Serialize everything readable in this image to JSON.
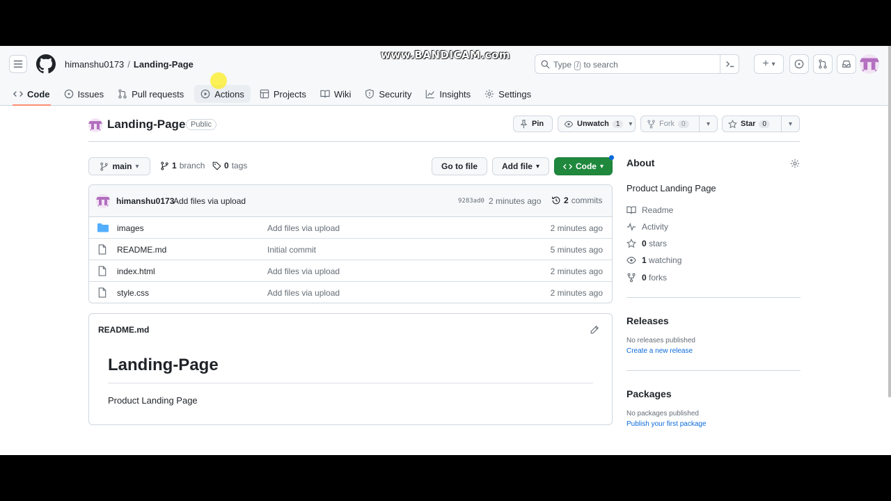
{
  "watermark": "www.BANDICAM.com",
  "header": {
    "owner": "himanshu0173",
    "separator": "/",
    "repo": "Landing-Page",
    "search_placeholder_a": "Type",
    "search_key": "/",
    "search_placeholder_b": "to search",
    "plus": "+",
    "caret": "▾"
  },
  "tabs": [
    {
      "label": "Code"
    },
    {
      "label": "Issues"
    },
    {
      "label": "Pull requests"
    },
    {
      "label": "Actions"
    },
    {
      "label": "Projects"
    },
    {
      "label": "Wiki"
    },
    {
      "label": "Security"
    },
    {
      "label": "Insights"
    },
    {
      "label": "Settings"
    }
  ],
  "repo": {
    "name": "Landing-Page",
    "visibility": "Public",
    "pin": "Pin",
    "unwatch": "Unwatch",
    "watch_count": "1",
    "fork": "Fork",
    "fork_count": "0",
    "star": "Star",
    "star_count": "0"
  },
  "branchbar": {
    "branch": "main",
    "branch_count": "1",
    "branch_label": "branch",
    "tag_count": "0",
    "tag_label": "tags",
    "go_to_file": "Go to file",
    "add_file": "Add file",
    "code": "Code"
  },
  "commit": {
    "author": "himanshu0173",
    "message": "Add files via upload",
    "sha": "9283ad0",
    "ago": "2 minutes ago",
    "count": "2",
    "count_label": "commits"
  },
  "files": [
    {
      "name": "images",
      "type": "folder",
      "message": "Add files via upload",
      "age": "2 minutes ago"
    },
    {
      "name": "README.md",
      "type": "file",
      "message": "Initial commit",
      "age": "5 minutes ago"
    },
    {
      "name": "index.html",
      "type": "file",
      "message": "Add files via upload",
      "age": "2 minutes ago"
    },
    {
      "name": "style.css",
      "type": "file",
      "message": "Add files via upload",
      "age": "2 minutes ago"
    }
  ],
  "readme": {
    "filename": "README.md",
    "heading": "Landing-Page",
    "body": "Product Landing Page"
  },
  "about": {
    "title": "About",
    "description": "Product Landing Page",
    "readme": "Readme",
    "activity": "Activity",
    "stars_count": "0",
    "stars_label": "stars",
    "watching_count": "1",
    "watching_label": "watching",
    "forks_count": "0",
    "forks_label": "forks"
  },
  "releases": {
    "title": "Releases",
    "empty": "No releases published",
    "link": "Create a new release"
  },
  "packages": {
    "title": "Packages",
    "empty": "No packages published",
    "link": "Publish your first package"
  },
  "colors": {
    "accent_tab": "#fd8c73",
    "code_button": "#1f883d",
    "link": "#0969da",
    "folder": "#54aeff"
  }
}
